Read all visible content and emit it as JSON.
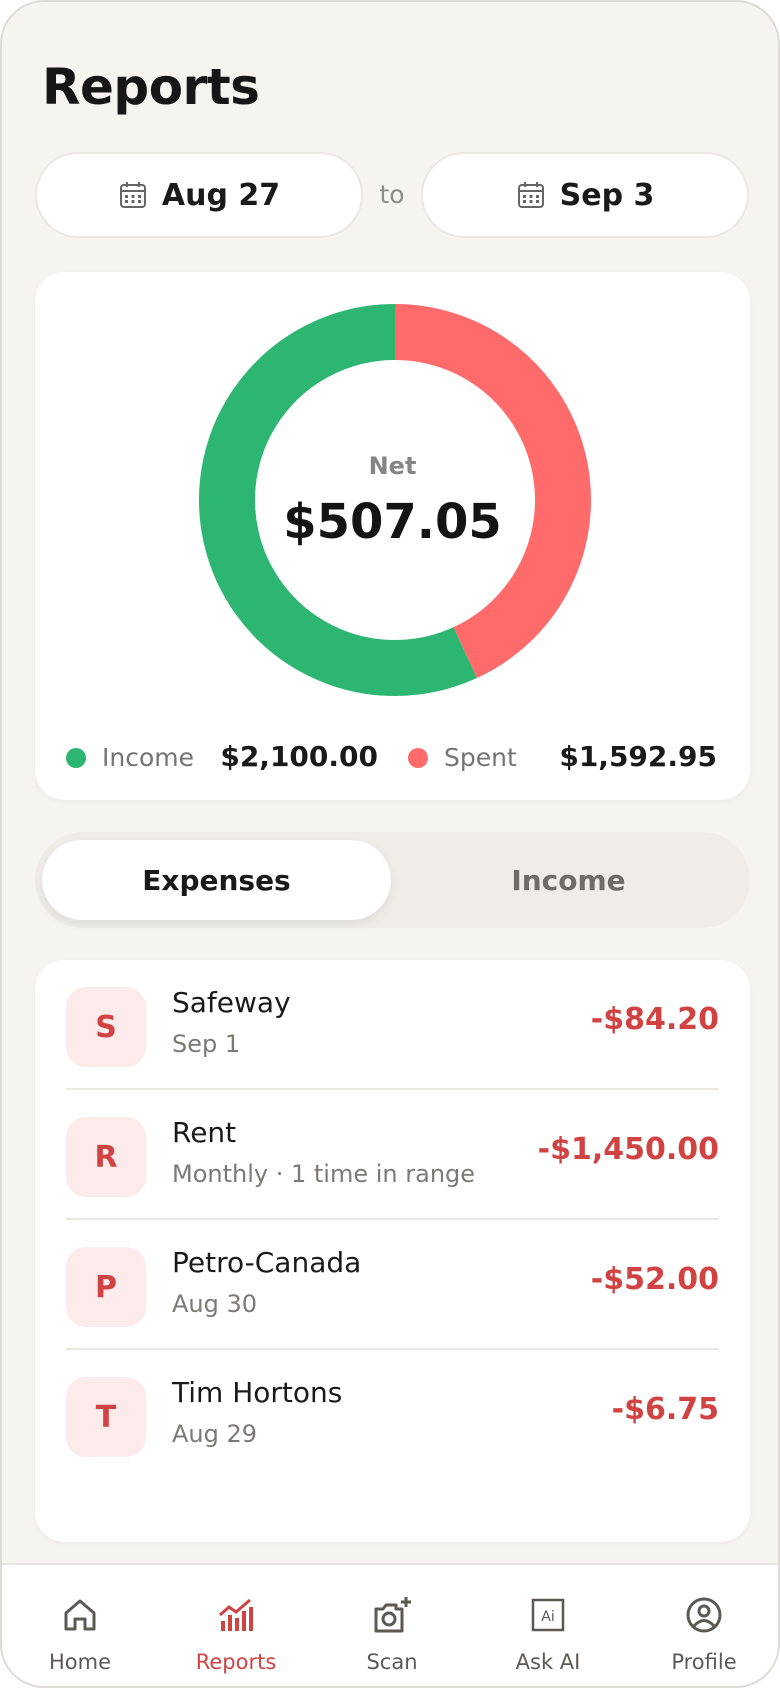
{
  "page": {
    "title": "Reports"
  },
  "date_range": {
    "from": "Aug 27",
    "separator": "to",
    "to": "Sep 3"
  },
  "summary": {
    "net_label": "Net",
    "net_value": "$507.05",
    "income_label": "Income",
    "income_value": "$2,100.00",
    "spent_label": "Spent",
    "spent_value": "$1,592.95",
    "income_amount": 2100.0,
    "spent_amount": 1592.95,
    "income_color": "#2db672",
    "spent_color": "#ff6b6b"
  },
  "toggle": {
    "expenses_label": "Expenses",
    "income_label": "Income",
    "active": "Expenses"
  },
  "transactions": [
    {
      "initial": "S",
      "name": "Safeway",
      "sub": "Sep 1",
      "amount": "-$84.20"
    },
    {
      "initial": "R",
      "name": "Rent",
      "sub": "Monthly · 1 time in range",
      "amount": "-$1,450.00"
    },
    {
      "initial": "P",
      "name": "Petro-Canada",
      "sub": "Aug 30",
      "amount": "-$52.00"
    },
    {
      "initial": "T",
      "name": "Tim Hortons",
      "sub": "Aug 29",
      "amount": "-$6.75"
    }
  ],
  "nav": [
    {
      "label": "Home",
      "icon": "home-icon"
    },
    {
      "label": "Reports",
      "icon": "chart-icon",
      "active": true
    },
    {
      "label": "Scan",
      "icon": "camera-plus-icon"
    },
    {
      "label": "Ask AI",
      "icon": "ai-icon"
    },
    {
      "label": "Profile",
      "icon": "profile-icon"
    }
  ],
  "colors": {
    "accent": "#d14343",
    "background": "#f6f4f1",
    "card": "#ffffff"
  }
}
